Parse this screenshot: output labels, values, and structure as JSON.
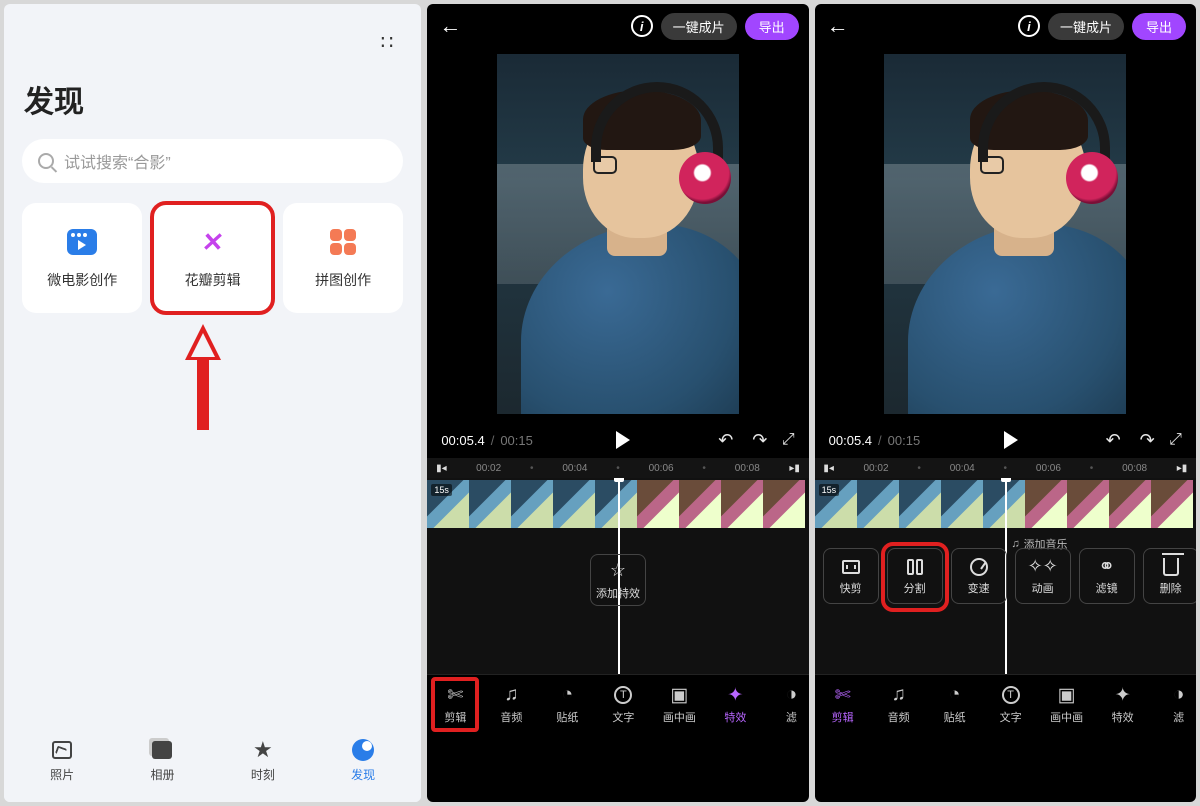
{
  "panel1": {
    "title": "发现",
    "search_placeholder": "试试搜索“合影”",
    "cards": [
      {
        "label": "微电影创作"
      },
      {
        "label": "花瓣剪辑",
        "highlighted": true
      },
      {
        "label": "拼图创作"
      }
    ],
    "bottom_tabs": [
      {
        "label": "照片"
      },
      {
        "label": "相册"
      },
      {
        "label": "时刻"
      },
      {
        "label": "发现",
        "active": true
      }
    ]
  },
  "editor_common": {
    "auto_chip": "一键成片",
    "export": "导出",
    "time_current": "00:05.4",
    "time_total": "00:15",
    "ruler": [
      "00:02",
      "00:04",
      "00:06",
      "00:08"
    ],
    "nav": [
      {
        "label": "剪辑",
        "icon": "scissors"
      },
      {
        "label": "音频",
        "icon": "music"
      },
      {
        "label": "贴纸",
        "icon": "sticker"
      },
      {
        "label": "文字",
        "icon": "text"
      },
      {
        "label": "画中画",
        "icon": "pip"
      },
      {
        "label": "特效",
        "icon": "sparkle"
      },
      {
        "label": "滤",
        "icon": "filter"
      }
    ]
  },
  "panel2": {
    "clip_badge": "15s",
    "fx_chip": "添加特效",
    "nav_active_index": 5,
    "nav_highlight_index": 0
  },
  "panel3": {
    "clip_badge": "15s",
    "music_hint": "添加音乐",
    "actions": [
      {
        "label": "快剪",
        "icon": "quick"
      },
      {
        "label": "分割",
        "icon": "split",
        "highlighted": true
      },
      {
        "label": "变速",
        "icon": "speed"
      },
      {
        "label": "动画",
        "icon": "anim"
      },
      {
        "label": "滤镜",
        "icon": "filt"
      },
      {
        "label": "删除",
        "icon": "del"
      }
    ],
    "nav_active_index": 0
  },
  "colors": {
    "accent_purple": "#a146ff",
    "highlight_red": "#e02020",
    "link_blue": "#2a7de8"
  }
}
